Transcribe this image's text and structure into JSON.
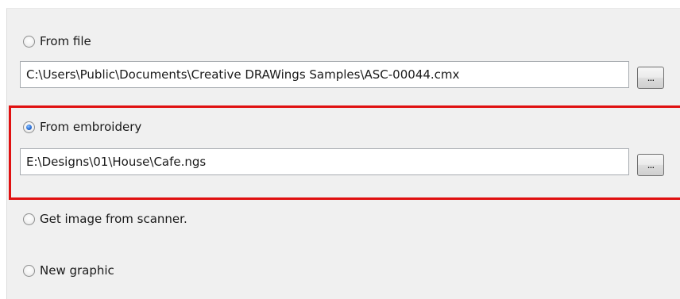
{
  "options": {
    "from_file": {
      "label": "From file",
      "checked": false,
      "path": "C:\\Users\\Public\\Documents\\Creative DRAWings Samples\\ASC-00044.cmx",
      "browse_label": "..."
    },
    "from_embroidery": {
      "label": "From embroidery",
      "checked": true,
      "path": "E:\\Designs\\01\\House\\Cafe.ngs",
      "browse_label": "..."
    },
    "from_scanner": {
      "label": "Get image from scanner.",
      "checked": false
    },
    "new_graphic": {
      "label": "New graphic",
      "checked": false
    }
  },
  "colors": {
    "highlight": "#e01010",
    "panel_bg": "#f0f0f0",
    "radio_selected": "#2a6fd8"
  }
}
